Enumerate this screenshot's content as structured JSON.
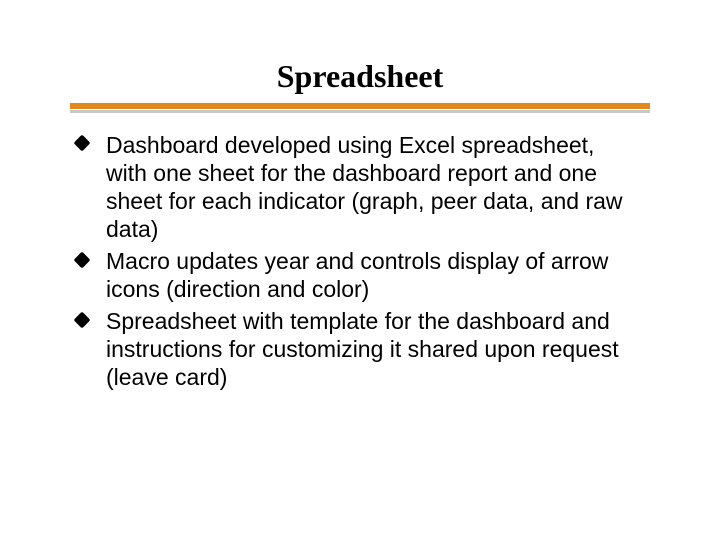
{
  "title": "Spreadsheet",
  "bullets": [
    "Dashboard developed using Excel spreadsheet, with one sheet for the dashboard report and one sheet for each indicator (graph, peer data, and raw data)",
    "Macro updates year and controls display of arrow icons (direction and color)",
    "Spreadsheet with template for the dashboard and instructions for customizing it  shared upon request (leave card)"
  ]
}
